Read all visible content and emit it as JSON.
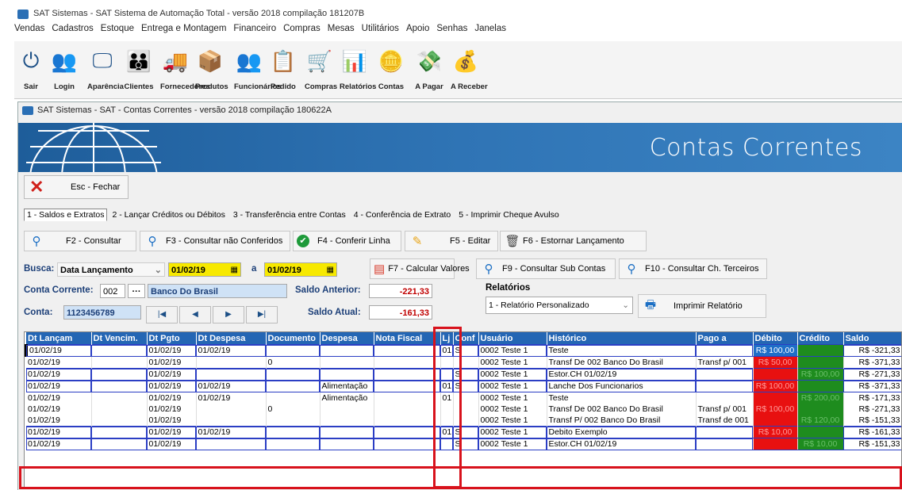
{
  "app": {
    "title": "SAT Sistemas - SAT Sistema de Automação Total - versão 2018 compilação 181207B",
    "menu": [
      "Vendas",
      "Cadastros",
      "Estoque",
      "Entrega e Montagem",
      "Financeiro",
      "Compras",
      "Mesas",
      "Utilitários",
      "Apoio",
      "Senhas",
      "Janelas"
    ],
    "toolbar": [
      {
        "label": "Sair",
        "icon": "power-icon"
      },
      {
        "label": "Login",
        "icon": "users-icon"
      },
      {
        "label": "Aparência",
        "icon": "monitor-icon"
      },
      {
        "label": "Clientes",
        "icon": "people-icon"
      },
      {
        "label": "Fornecedores",
        "icon": "truck-icon"
      },
      {
        "label": "Produtos",
        "icon": "boxes-icon"
      },
      {
        "label": "Funcionários",
        "icon": "staff-icon"
      },
      {
        "label": "Pedido",
        "icon": "list-icon"
      },
      {
        "label": "Compras",
        "icon": "cart-icon"
      },
      {
        "label": "Relatórios",
        "icon": "chart-icon"
      },
      {
        "label": "Contas",
        "icon": "coins-icon"
      },
      {
        "label": "A Pagar",
        "icon": "pay-icon"
      },
      {
        "label": "A Receber",
        "icon": "receive-icon"
      }
    ]
  },
  "window": {
    "title": "SAT Sistemas - SAT - Contas Correntes - versão 2018 compilação 180622A",
    "banner_title": "Contas Correntes",
    "close_label": "Esc - Fechar",
    "tabs": [
      "1 - Saldos e Extratos",
      "2 - Lançar Créditos ou Débitos",
      "3 - Transferência entre Contas",
      "4 - Conferência de Extrato",
      "5 - Imprimir Cheque Avulso"
    ],
    "actions": {
      "f2": "F2 - Consultar",
      "f3": "F3 - Consultar não Conferidos",
      "f4": "F4 - Conferir Linha",
      "f5": "F5 - Editar",
      "f6": "F6 - Estornar Lançamento",
      "f7": "F7 - Calcular Valores",
      "f9": "F9 - Consultar Sub Contas",
      "f10": "F10 - Consultar Ch. Terceiros"
    },
    "filters": {
      "busca_label": "Busca:",
      "busca_value": "Data Lançamento",
      "date_from": "01/02/19",
      "date_sep": "a",
      "date_to": "01/02/19",
      "conta_corrente_label": "Conta Corrente:",
      "conta_corrente_code": "002",
      "ellipsis": "···",
      "conta_corrente_name": "Banco Do Brasil",
      "conta_label": "Conta:",
      "conta_value": "1123456789",
      "saldo_anterior_label": "Saldo Anterior:",
      "saldo_anterior_value": "-221,33",
      "saldo_atual_label": "Saldo Atual:",
      "saldo_atual_value": "-161,33",
      "relatorios_label": "Relatórios",
      "relatorio_value": "1 - Relatório Personalizado",
      "imprimir_label": "Imprimir Relatório"
    },
    "grid": {
      "columns": [
        "Dt Lançam",
        "Dt Vencim.",
        "Dt Pgto",
        "Dt Despesa",
        "Documento",
        "Despesa",
        "Nota Fiscal",
        "Lj",
        "Conf",
        "Usuário",
        "Histórico",
        "Pago a",
        "Débito",
        "Crédito",
        "Saldo"
      ],
      "rows": [
        {
          "c": [
            "01/02/19",
            "",
            "01/02/19",
            "01/02/19",
            "",
            "",
            "",
            "01",
            "S",
            "0002 Teste 1",
            "Teste",
            "",
            "R$ 100,00",
            "",
            "R$ -321,33"
          ],
          "deb": "sel",
          "cre": "green",
          "box": true,
          "cur": true
        },
        {
          "c": [
            "01/02/19",
            "",
            "01/02/19",
            "",
            "0",
            "",
            "",
            "",
            "",
            "0002 Teste 1",
            "Transf De 002 Banco Do Brasil",
            "Transf p/ 001",
            "R$ 50,00",
            "",
            "R$ -371,33"
          ],
          "deb": "red",
          "cre": "green",
          "box": false
        },
        {
          "c": [
            "01/02/19",
            "",
            "01/02/19",
            "",
            "",
            "",
            "",
            "",
            "S",
            "0002 Teste 1",
            "Estor.CH  01/02/19",
            "",
            "",
            "R$ 100,00",
            "R$ -271,33"
          ],
          "deb": "red",
          "cre": "green",
          "box": true
        },
        {
          "c": [
            "01/02/19",
            "",
            "01/02/19",
            "01/02/19",
            "",
            "Alimentação",
            "",
            "01",
            "S",
            "0002 Teste 1",
            "Lanche Dos Funcionarios",
            "",
            "R$ 100,00",
            "",
            "R$ -371,33"
          ],
          "deb": "red",
          "cre": "green",
          "box": true
        },
        {
          "c": [
            "01/02/19",
            "",
            "01/02/19",
            "01/02/19",
            "",
            "Alimentação",
            "",
            "01",
            "",
            "0002 Teste 1",
            "Teste",
            "",
            "",
            "R$ 200,00",
            "R$ -171,33"
          ],
          "deb": "red",
          "cre": "green",
          "box": false
        },
        {
          "c": [
            "01/02/19",
            "",
            "01/02/19",
            "",
            "0",
            "",
            "",
            "",
            "",
            "0002 Teste 1",
            "Transf De 002 Banco Do Brasil",
            "Transf p/ 001",
            "R$ 100,00",
            "",
            "R$ -271,33"
          ],
          "deb": "red",
          "cre": "green",
          "box": false
        },
        {
          "c": [
            "01/02/19",
            "",
            "01/02/19",
            "",
            "",
            "",
            "",
            "",
            "",
            "0002 Teste 1",
            "Transf P/ 002 Banco Do Brasil",
            "Transf de 001",
            "",
            "R$ 120,00",
            "R$ -151,33"
          ],
          "deb": "red",
          "cre": "green",
          "box": false
        },
        {
          "c": [
            "01/02/19",
            "",
            "01/02/19",
            "01/02/19",
            "",
            "",
            "",
            "01",
            "S",
            "0002 Teste 1",
            "Debito Exemplo",
            "",
            "R$ 10,00",
            "",
            "R$ -161,33"
          ],
          "deb": "red",
          "cre": "green",
          "box": true
        },
        {
          "c": [
            "01/02/19",
            "",
            "01/02/19",
            "",
            "",
            "",
            "",
            "",
            "S",
            "0002 Teste 1",
            "Estor.CH  01/02/19",
            "",
            "",
            "R$ 10,00",
            "R$ -151,33"
          ],
          "deb": "red",
          "cre": "green",
          "box": true
        }
      ]
    }
  },
  "colors": {
    "accent": "#2466b4",
    "debit": "#e81010",
    "credit": "#1e8c1e",
    "highlight": "#d8121c",
    "date_field": "#f7e900"
  }
}
